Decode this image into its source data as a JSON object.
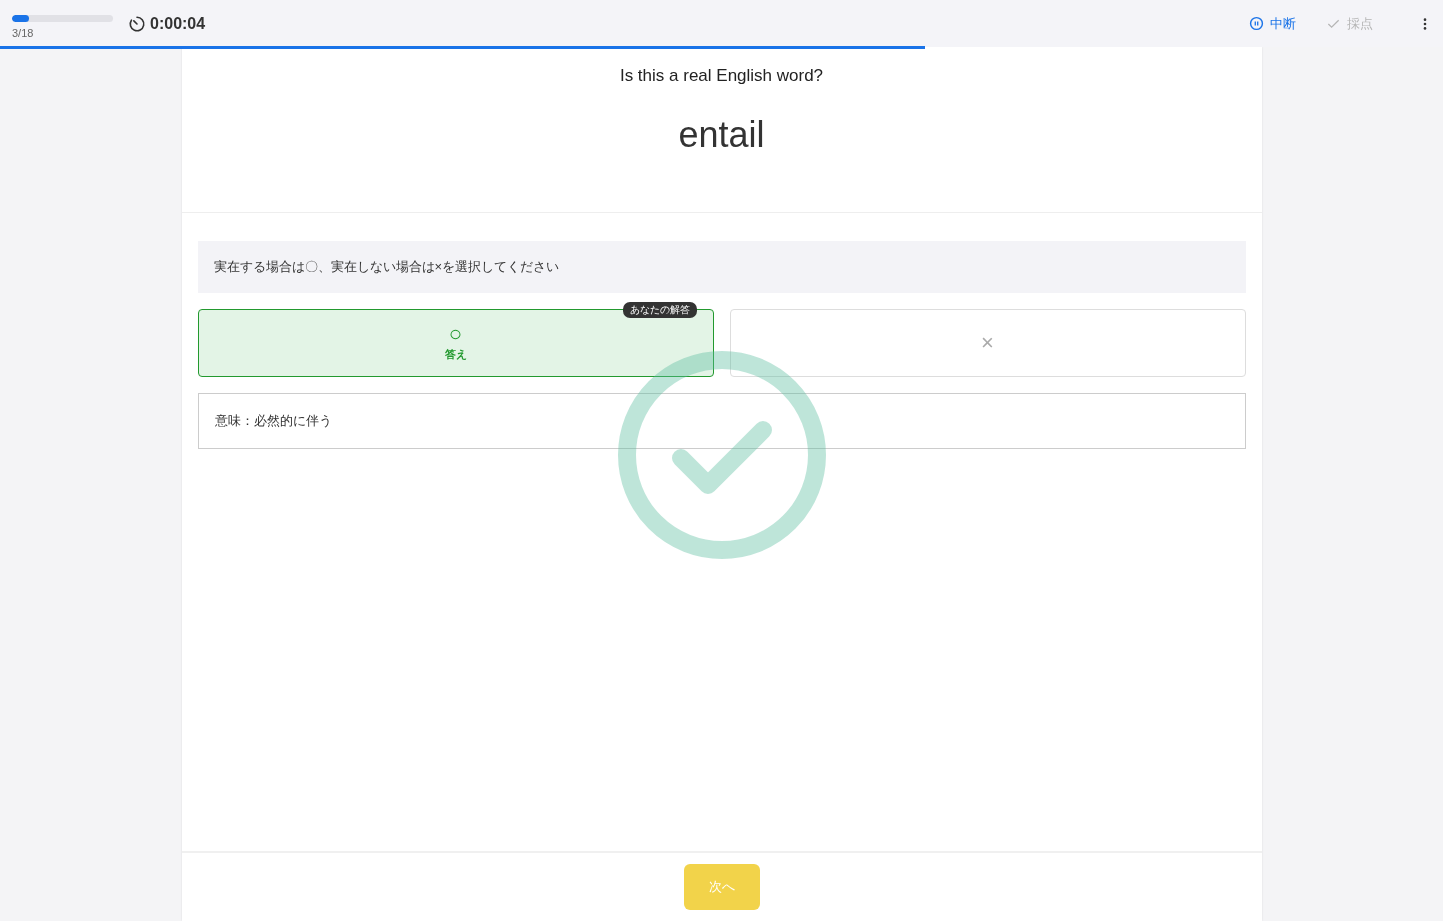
{
  "header": {
    "progress": {
      "level": 0.17,
      "count": "3/18"
    },
    "timer": "0:00:04",
    "actions": [
      {
        "kind": "pause",
        "label": "中断",
        "disabled": false
      },
      {
        "kind": "grade",
        "label": "採点",
        "disabled": true
      }
    ],
    "time_bar": {
      "level": 0.641
    }
  },
  "question": {
    "prompt": "Is this a real English word?",
    "word": "entail"
  },
  "instruction": "実在する場合は〇、実在しない場合は×を選択してください",
  "answer_badge": "あなたの解答",
  "choices": [
    {
      "symbol": "○",
      "label": "答え",
      "correct": true,
      "selected": true
    },
    {
      "symbol": "×",
      "correct": false,
      "selected": false
    }
  ],
  "meaning": "意味：必然的に伴う",
  "answered_correctly": true,
  "next_button": "次へ"
}
